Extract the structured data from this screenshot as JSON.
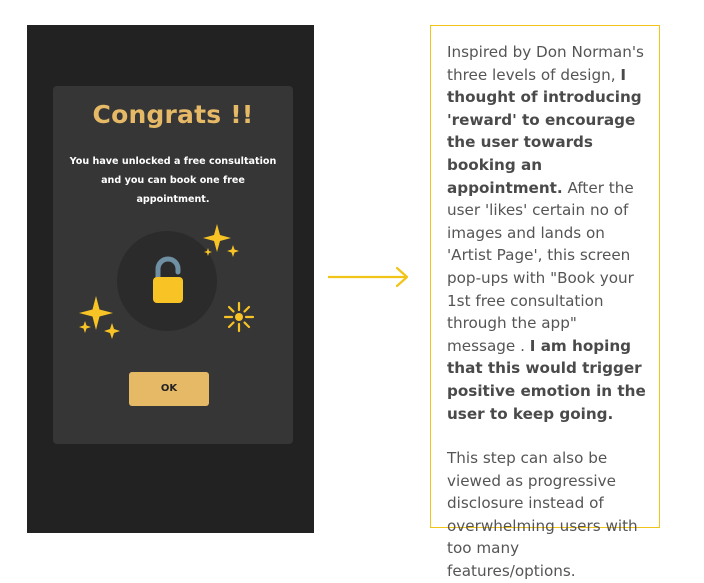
{
  "modal": {
    "title": "Congrats !!",
    "message": "You have unlocked a free consultation and you can book one free appointment.",
    "ok_label": "OK"
  },
  "icons": {
    "lock": "unlocked-padlock-icon",
    "sparkles": [
      "sparkles-icon",
      "sparkles-icon",
      "burst-sparkle-icon"
    ],
    "arrow": "right-arrow-icon"
  },
  "note": {
    "p1_a": "Inspired by Don Norman's three levels of design, ",
    "p1_b": "I thought of introducing 'reward' to encourage the user towards booking an appointment.",
    "p1_c": " After the user 'likes' certain no of images and lands on 'Artist Page', this screen pop-ups with \"Book your 1st free consultation through the app\" message . ",
    "p1_d": "I am hoping that this would trigger positive emotion in the user to keep going.",
    "p2": "This step can also be viewed as progressive disclosure instead of overwhelming users with too many features/options."
  },
  "colors": {
    "background": "#ffffff",
    "phone_bg": "#222222",
    "card_bg": "#363636",
    "accent_gold": "#e6b967",
    "lock_yellow": "#f7c325",
    "note_border": "#f0c419",
    "text_gray": "#555555"
  }
}
